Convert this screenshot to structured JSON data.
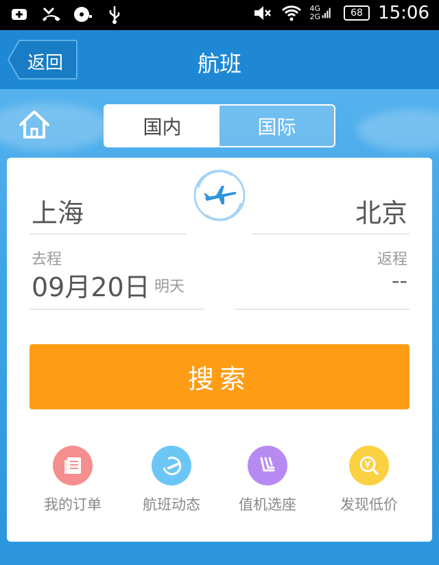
{
  "status_bar": {
    "network_top": "4G",
    "network_bottom": "2G",
    "battery": "68",
    "time": "15:06"
  },
  "nav": {
    "back_label": "返回",
    "title": "航班"
  },
  "tabs": [
    {
      "label": "国内",
      "active": true
    },
    {
      "label": "国际",
      "active": false
    }
  ],
  "route": {
    "from_city": "上海",
    "to_city": "北京"
  },
  "dates": {
    "depart_label": "去程",
    "depart_date": "09月20日",
    "depart_hint": "明天",
    "return_label": "返程",
    "return_value": "--"
  },
  "search_label": "搜索",
  "quick_links": [
    {
      "label": "我的订单",
      "icon": "order-list-icon",
      "color": "#f58e8e"
    },
    {
      "label": "航班动态",
      "icon": "flight-status-icon",
      "color": "#6cc6f5"
    },
    {
      "label": "值机选座",
      "icon": "seat-select-icon",
      "color": "#b78af2"
    },
    {
      "label": "发现低价",
      "icon": "low-price-icon",
      "color": "#fbd041"
    }
  ],
  "colors": {
    "primary_blue": "#1e88d4",
    "search_orange": "#ff9c16"
  }
}
